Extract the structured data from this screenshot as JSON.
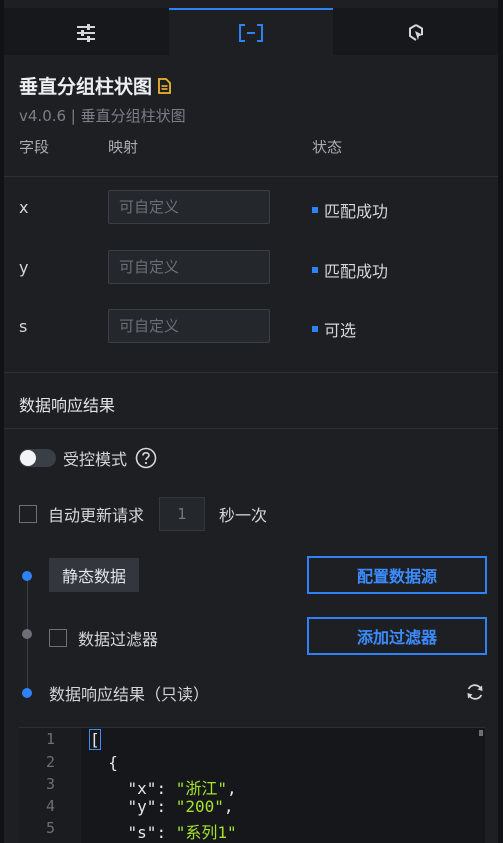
{
  "tabs": [
    {
      "icon": "sliders-icon",
      "active": false
    },
    {
      "icon": "bracket-data-icon",
      "active": true
    },
    {
      "icon": "interaction-cursor-icon",
      "active": false
    }
  ],
  "header": {
    "title": "垂直分组柱状图",
    "version_line": "v4.0.6 | 垂直分组柱状图",
    "doc_icon": "document-icon"
  },
  "mapping": {
    "columns": [
      "字段",
      "映射",
      "状态"
    ],
    "rows": [
      {
        "field": "x",
        "placeholder": "可自定义",
        "status": "匹配成功"
      },
      {
        "field": "y",
        "placeholder": "可自定义",
        "status": "匹配成功"
      },
      {
        "field": "s",
        "placeholder": "可自定义",
        "status": "可选"
      }
    ]
  },
  "response": {
    "section_title": "数据响应结果",
    "controlled_mode_label": "受控模式",
    "controlled_mode_on": false,
    "auto_refresh_label": "自动更新请求",
    "auto_refresh_checked": false,
    "interval_placeholder": "1",
    "interval_unit": "秒一次"
  },
  "pipeline": {
    "static_data_label": "静态数据",
    "configure_source_button": "配置数据源",
    "filter_label": "数据过滤器",
    "filter_checked": false,
    "add_filter_button": "添加过滤器",
    "result_label": "数据响应结果（只读）"
  },
  "editor": {
    "line_numbers": [
      "1",
      "2",
      "3",
      "4",
      "5"
    ],
    "lines": [
      "[",
      "  {",
      "    \"x\": \"浙江\",",
      "    \"y\": \"200\",",
      "    \"s\": \"系列1\""
    ]
  },
  "colors": {
    "accent": "#2f82f5",
    "title_icon": "#f0b429",
    "string_literal": "#a6e22e"
  }
}
